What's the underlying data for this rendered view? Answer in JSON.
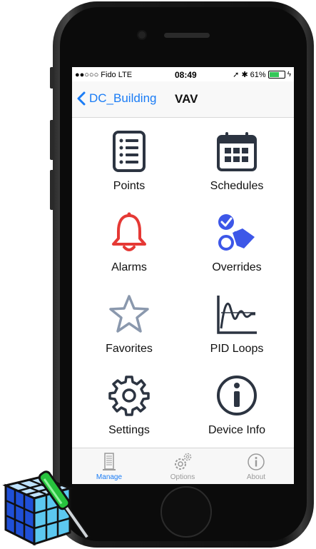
{
  "status": {
    "carrier": "●●○○○ Fido  LTE",
    "time": "08:49",
    "battery": "61%",
    "battery_level": 0.61,
    "indicators": "➚ ✱"
  },
  "nav": {
    "back_label": "DC_Building",
    "title": "VAV"
  },
  "tiles": [
    {
      "label": "Points",
      "icon": "list-icon"
    },
    {
      "label": "Schedules",
      "icon": "calendar-icon"
    },
    {
      "label": "Alarms",
      "icon": "bell-icon"
    },
    {
      "label": "Overrides",
      "icon": "override-icon"
    },
    {
      "label": "Favorites",
      "icon": "star-icon"
    },
    {
      "label": "PID Loops",
      "icon": "pid-graph-icon"
    },
    {
      "label": "Settings",
      "icon": "gear-icon"
    },
    {
      "label": "Device Info",
      "icon": "info-icon"
    }
  ],
  "tabs": [
    {
      "label": "Manage",
      "icon": "server-icon",
      "active": true
    },
    {
      "label": "Options",
      "icon": "gears-icon",
      "active": false
    },
    {
      "label": "About",
      "icon": "info-icon",
      "active": false
    }
  ],
  "colors": {
    "accent": "#1a7cf5",
    "alarm": "#e53935",
    "override": "#3d57e8",
    "icon_dark": "#2c3441",
    "star": "#8a98ad"
  }
}
